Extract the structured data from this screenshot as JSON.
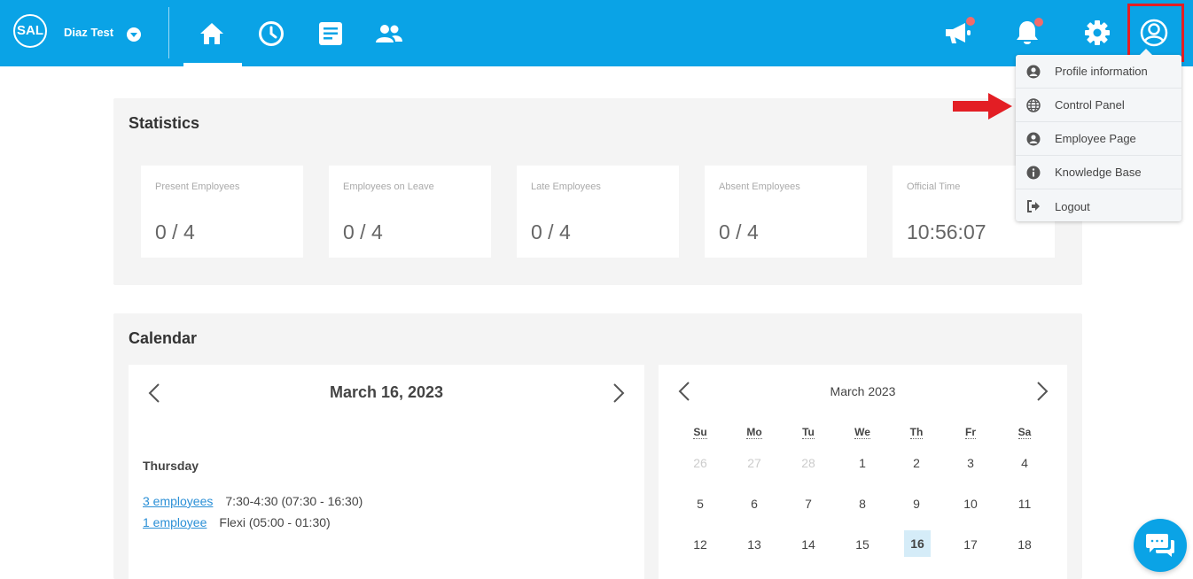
{
  "header": {
    "logo_text": "SAL",
    "company_name": "Diaz Test",
    "nav": [
      "home-icon",
      "clock-icon",
      "document-icon",
      "users-icon"
    ],
    "right_icons": [
      "megaphone-icon",
      "bell-icon",
      "gear-icon",
      "user-circle-icon"
    ],
    "colors": {
      "bar": "#0aa3e6",
      "notification_dot": "#f26b6b",
      "highlight": "#e31e24"
    }
  },
  "user_menu": {
    "items": [
      {
        "label": "Profile information",
        "icon": "user-icon"
      },
      {
        "label": "Control Panel",
        "icon": "globe-icon"
      },
      {
        "label": "Employee Page",
        "icon": "user-icon"
      },
      {
        "label": "Knowledge Base",
        "icon": "info-icon"
      },
      {
        "label": "Logout",
        "icon": "logout-icon"
      }
    ]
  },
  "statistics": {
    "title": "Statistics",
    "cards": [
      {
        "label": "Present Employees",
        "value": "0 / 4"
      },
      {
        "label": "Employees on Leave",
        "value": "0 / 4"
      },
      {
        "label": "Late Employees",
        "value": "0 / 4"
      },
      {
        "label": "Absent Employees",
        "value": "0 / 4"
      },
      {
        "label": "Official Time",
        "value": "10:56:07"
      }
    ]
  },
  "calendar": {
    "title": "Calendar",
    "day_view": {
      "date": "March 16, 2023",
      "weekday": "Thursday",
      "shifts": [
        {
          "link": "3 employees",
          "text": "7:30-4:30 (07:30 - 16:30)"
        },
        {
          "link": "1 employee",
          "text": "Flexi (05:00 - 01:30)"
        }
      ]
    },
    "month_view": {
      "title": "March 2023",
      "weekdays": [
        "Su",
        "Mo",
        "Tu",
        "We",
        "Th",
        "Fr",
        "Sa"
      ],
      "weeks": [
        [
          "26",
          "27",
          "28",
          "1",
          "2",
          "3",
          "4"
        ],
        [
          "5",
          "6",
          "7",
          "8",
          "9",
          "10",
          "11"
        ],
        [
          "12",
          "13",
          "14",
          "15",
          "16",
          "17",
          "18"
        ]
      ],
      "selected": "16"
    }
  }
}
